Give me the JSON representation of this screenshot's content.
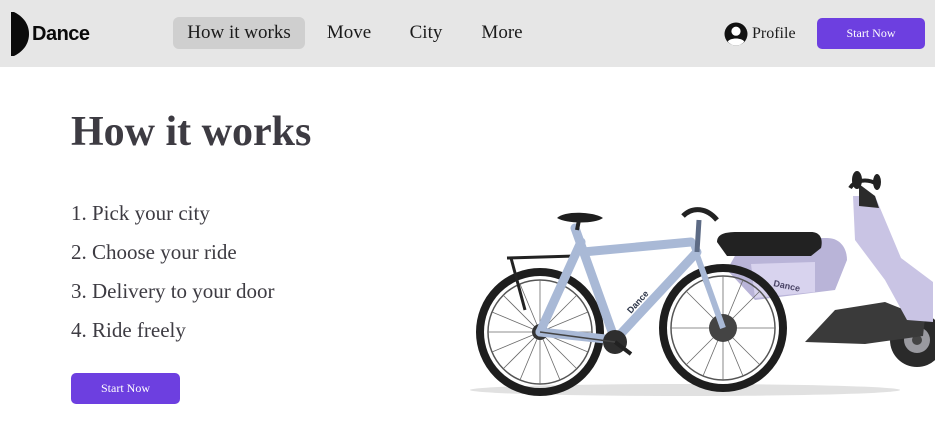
{
  "header": {
    "brand": "Dance",
    "nav": [
      {
        "label": "How it works",
        "active": true
      },
      {
        "label": "Move",
        "active": false
      },
      {
        "label": "City",
        "active": false
      },
      {
        "label": "More",
        "active": false
      }
    ],
    "profile_label": "Profile",
    "cta_label": "Start Now"
  },
  "hero": {
    "title": "How it works",
    "steps": [
      "1. Pick your city",
      "2. Choose your ride",
      "3. Delivery to your door",
      "4. Ride freely"
    ],
    "cta_label": "Start Now",
    "image": {
      "subject": "e-bike-and-e-moped",
      "frame_brand": "Dance",
      "moped_brand": "Dance"
    }
  },
  "icons": {
    "logo": "dance-logo-mark",
    "profile": "user-avatar-icon"
  },
  "colors": {
    "accent": "#6d3fe0",
    "nav_background": "#e6e6e6",
    "nav_active": "#cfcfcf",
    "heading_text": "#3d3b42",
    "page_background": "#ffffff"
  }
}
